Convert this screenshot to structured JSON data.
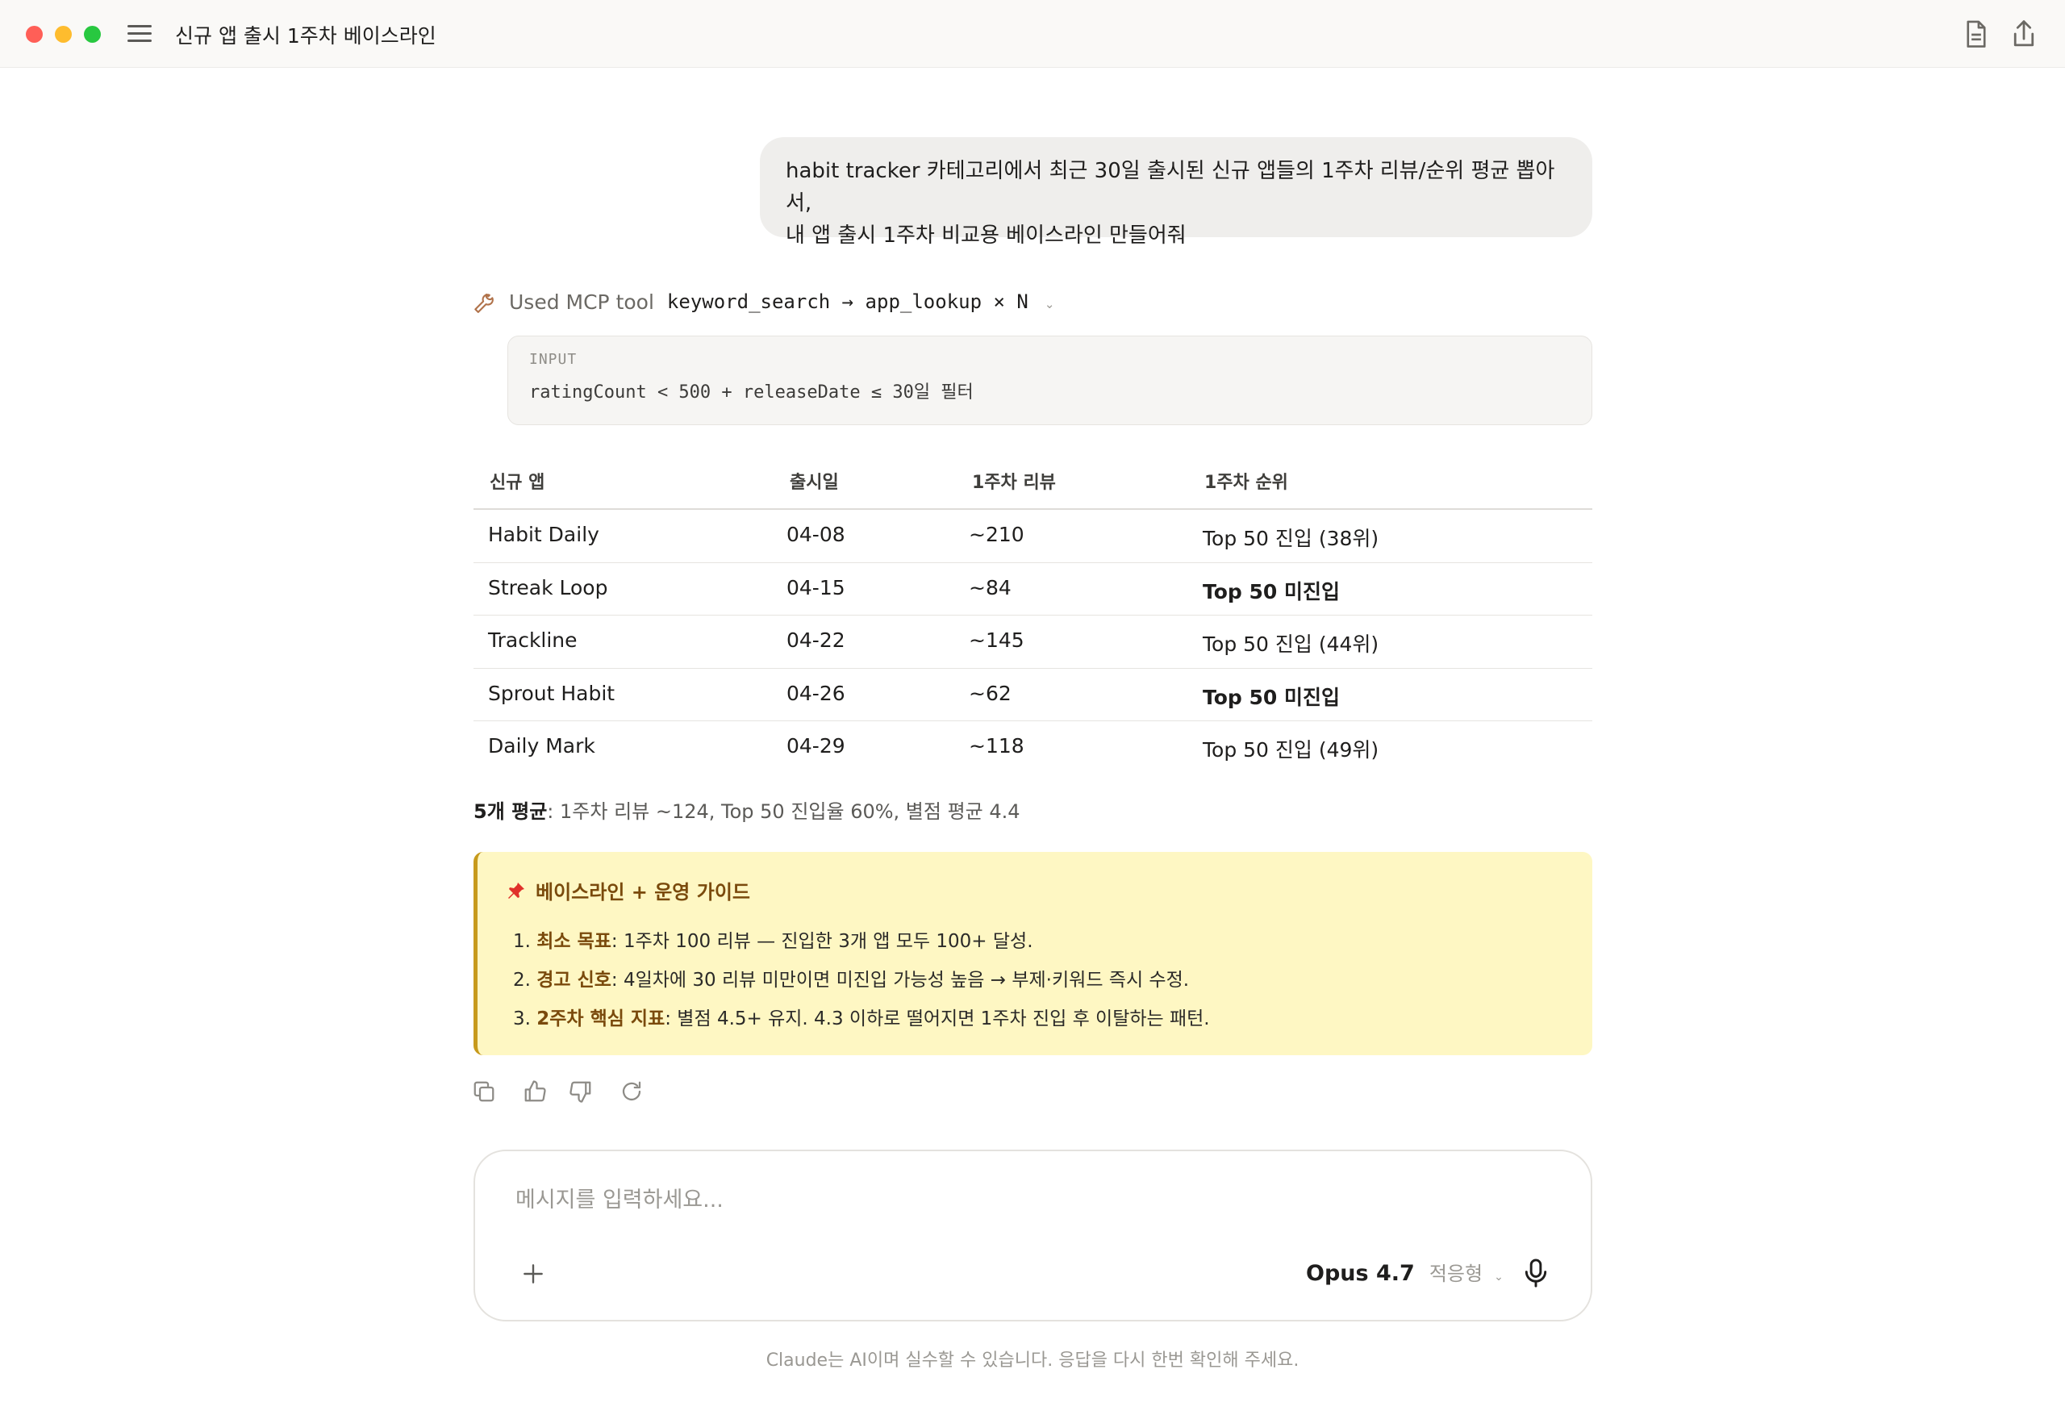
{
  "window": {
    "title": "신규 앱 출시 1주차 베이스라인"
  },
  "user_message": {
    "line1": "habit tracker 카테고리에서 최근 30일 출시된 신규 앱들의 1주차 리뷰/순위 평균 뽑아서,",
    "line2": "내 앱 출시 1주차 비교용 베이스라인 만들어줘"
  },
  "tool_use": {
    "label": "Used MCP tool",
    "code": "keyword_search → app_lookup × N",
    "input_label": "INPUT",
    "input_code": "ratingCount < 500 + releaseDate ≤ 30일 필터"
  },
  "table": {
    "headers": [
      "신규 앱",
      "출시일",
      "1주차 리뷰",
      "1주차 순위"
    ],
    "rows": [
      {
        "app": "Habit Daily",
        "date": "04-08",
        "reviews": "~210",
        "rank": "Top 50 진입 (38위)",
        "bold": false
      },
      {
        "app": "Streak Loop",
        "date": "04-15",
        "reviews": "~84",
        "rank": "Top 50 미진입",
        "bold": true
      },
      {
        "app": "Trackline",
        "date": "04-22",
        "reviews": "~145",
        "rank": "Top 50 진입 (44위)",
        "bold": false
      },
      {
        "app": "Sprout Habit",
        "date": "04-26",
        "reviews": "~62",
        "rank": "Top 50 미진입",
        "bold": true
      },
      {
        "app": "Daily Mark",
        "date": "04-29",
        "reviews": "~118",
        "rank": "Top 50 진입 (49위)",
        "bold": false
      }
    ]
  },
  "summary": {
    "label": "5개 평균",
    "text": ": 1주차 리뷰 ~124, Top 50 진입율 60%, 별점 평균 4.4"
  },
  "callout": {
    "icon": "pushpin-icon",
    "title": "베이스라인 + 운영 가이드",
    "items": [
      {
        "num": "1.",
        "key": "최소 목표",
        "text": ": 1주차 100 리뷰 — 진입한 3개 앱 모두 100+ 달성."
      },
      {
        "num": "2.",
        "key": "경고 신호",
        "text": ": 4일차에 30 리뷰 미만이면 미진입 가능성 높음 → 부제·키워드 즉시 수정."
      },
      {
        "num": "3.",
        "key": "2주차 핵심 지표",
        "text": ": 별점 4.5+ 유지. 4.3 이하로 떨어지면 1주차 진입 후 이탈하는 패턴."
      }
    ]
  },
  "composer": {
    "placeholder": "메시지를 입력하세요...",
    "model": "Opus 4.7",
    "mode": "적응형"
  },
  "disclaimer": "Claude는 AI이며 실수할 수 있습니다. 응답을 다시 한번 확인해 주세요.",
  "colors": {
    "callout_bg": "#fef7c3",
    "callout_accent": "#c79a1c",
    "callout_key": "#7a4a0c"
  }
}
